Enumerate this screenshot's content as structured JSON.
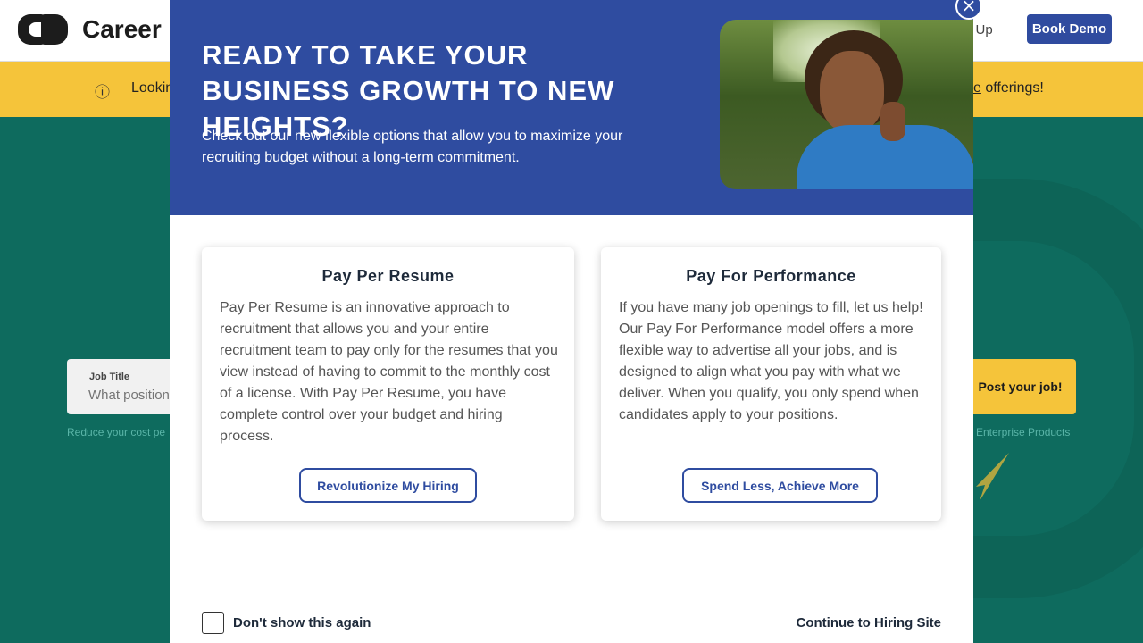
{
  "header": {
    "logo_text": "Career",
    "signup_label": "n Up",
    "book_demo_label": "Book Demo"
  },
  "notice": {
    "icon": "info-icon",
    "text_start": "Lookin",
    "text_end_link": "e",
    "text_end": " offerings!"
  },
  "search": {
    "label": "Job Title",
    "placeholder": "What position",
    "hint": "Reduce your cost pe"
  },
  "post_job": {
    "label": "Post your job!",
    "enterprise_text": "Enterprise Products"
  },
  "modal": {
    "title": "READY TO TAKE YOUR BUSINESS GROWTH TO NEW HEIGHTS?",
    "subtitle": "Check out our new flexible options that allow you to maximize your recruiting budget without a long-term commitment.",
    "close_icon": "close-icon",
    "cards": [
      {
        "title": "Pay Per Resume",
        "body": "Pay Per Resume is an innovative approach to recruitment that allows you and your entire recruitment team to pay only for the resumes that you view instead of having to commit to the monthly cost of a license. With Pay Per Resume, you have complete control over your budget and hiring process.",
        "button": "Revolutionize My Hiring"
      },
      {
        "title": "Pay For Performance",
        "body": "If you have many job openings to fill, let us help! Our Pay For Performance model offers a more flexible way to advertise all your jobs, and is designed to align what you pay with what we deliver. When you qualify, you only spend when candidates apply to your positions.",
        "button": "Spend Less, Achieve More"
      }
    ],
    "dont_show_label": "Don't show this again",
    "continue_label": "Continue to Hiring Site"
  },
  "colors": {
    "brand_blue": "#2f4ca0",
    "notice_yellow": "#f5c43a",
    "background_teal": "#0e6b5e"
  }
}
